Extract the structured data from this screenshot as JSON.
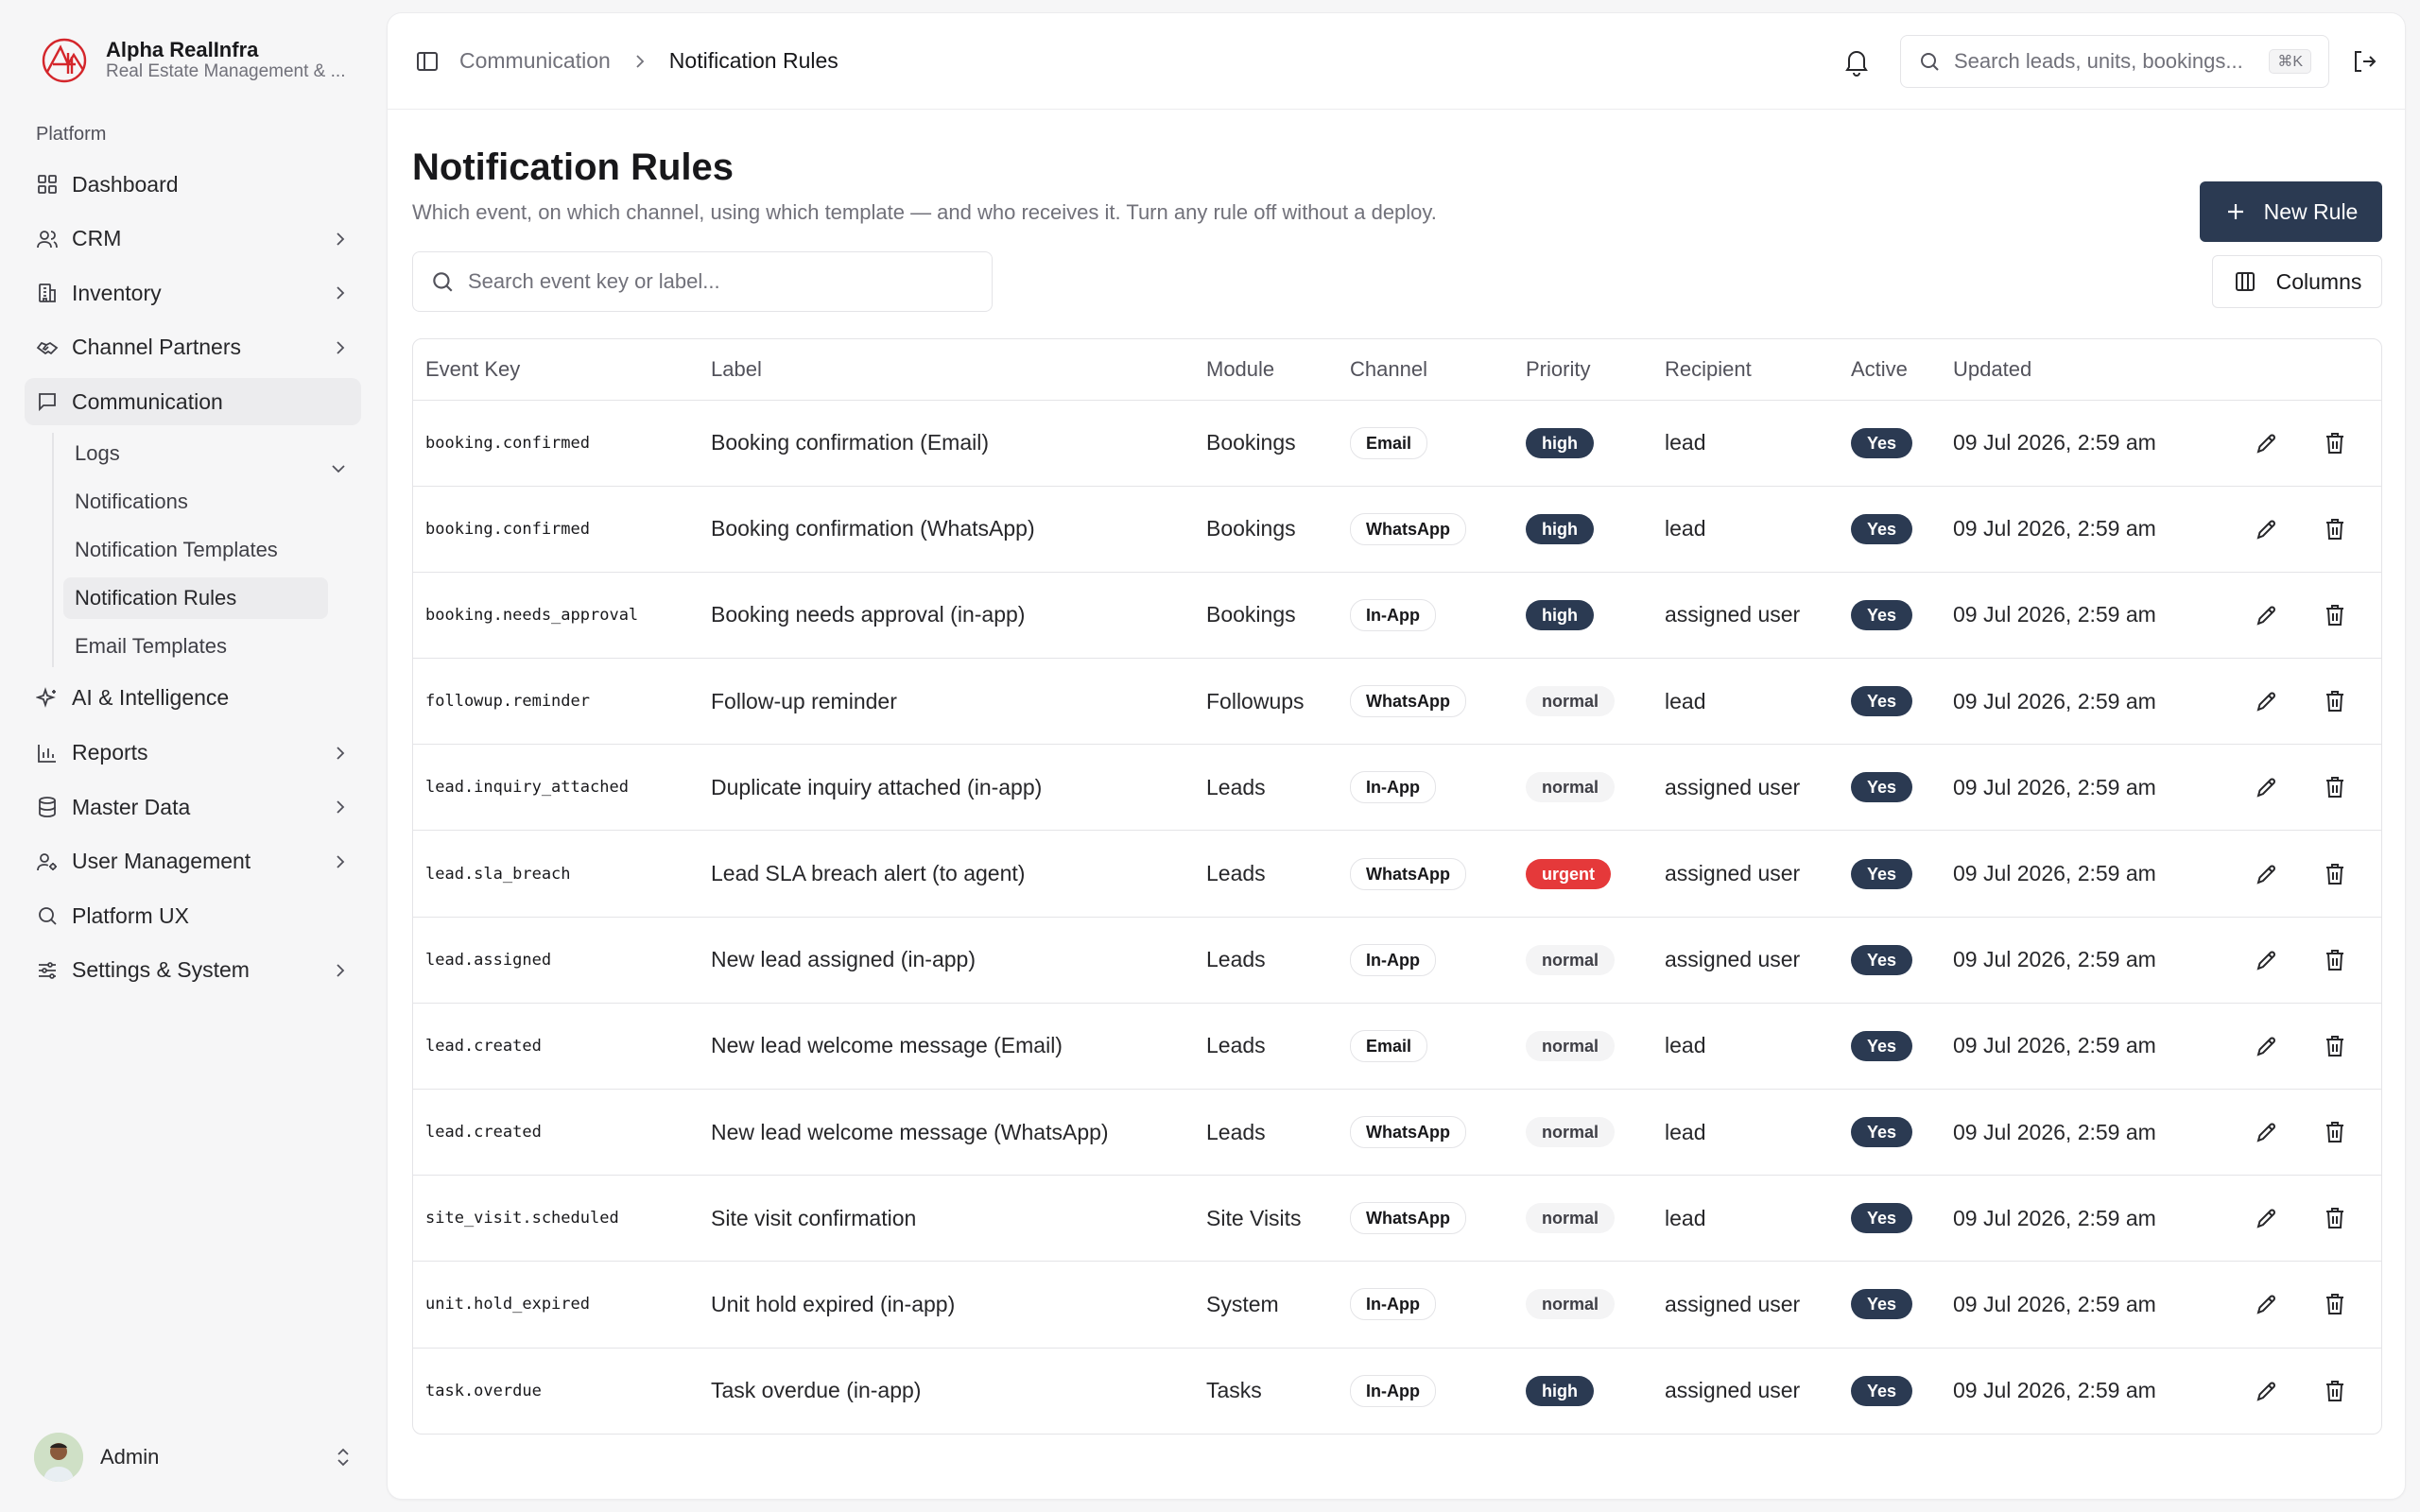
{
  "brand": {
    "name": "Alpha RealInfra",
    "subtitle": "Real Estate Management & ...",
    "accent": "#d4262b"
  },
  "sidebar": {
    "section_label": "Platform",
    "items": [
      {
        "label": "Dashboard",
        "icon": "grid-icon"
      },
      {
        "label": "CRM",
        "icon": "users-icon"
      },
      {
        "label": "Inventory",
        "icon": "building-icon"
      },
      {
        "label": "Channel Partners",
        "icon": "handshake-icon"
      },
      {
        "label": "Communication",
        "icon": "message-icon"
      },
      {
        "label": "AI & Intelligence",
        "icon": "sparkles-icon"
      },
      {
        "label": "Reports",
        "icon": "bar-chart-icon"
      },
      {
        "label": "Master Data",
        "icon": "database-icon"
      },
      {
        "label": "User Management",
        "icon": "user-cog-icon"
      },
      {
        "label": "Platform UX",
        "icon": "search-icon"
      },
      {
        "label": "Settings & System",
        "icon": "sliders-icon"
      }
    ],
    "sub_items": [
      {
        "label": "Logs"
      },
      {
        "label": "Notifications"
      },
      {
        "label": "Notification Templates"
      },
      {
        "label": "Notification Rules"
      },
      {
        "label": "Email Templates"
      }
    ]
  },
  "user": {
    "name": "Admin"
  },
  "topbar": {
    "breadcrumb_parent": "Communication",
    "breadcrumb_current": "Notification Rules",
    "search_placeholder": "Search leads, units, bookings...",
    "shortcut": "⌘K"
  },
  "page": {
    "title": "Notification Rules",
    "description": "Which event, on which channel, using which template — and who receives it. Turn any rule off without a deploy.",
    "new_button": "New Rule",
    "search_placeholder": "Search event key or label...",
    "columns_button": "Columns"
  },
  "table": {
    "headers": [
      "Event Key",
      "Label",
      "Module",
      "Channel",
      "Priority",
      "Recipient",
      "Active",
      "Updated"
    ],
    "rows": [
      {
        "event_key": "booking.confirmed",
        "label": "Booking confirmation (Email)",
        "module": "Bookings",
        "channel": "Email",
        "priority": "high",
        "recipient": "lead",
        "active": "Yes",
        "updated": "09 Jul 2026, 2:59 am"
      },
      {
        "event_key": "booking.confirmed",
        "label": "Booking confirmation (WhatsApp)",
        "module": "Bookings",
        "channel": "WhatsApp",
        "priority": "high",
        "recipient": "lead",
        "active": "Yes",
        "updated": "09 Jul 2026, 2:59 am"
      },
      {
        "event_key": "booking.needs_approval",
        "label": "Booking needs approval (in-app)",
        "module": "Bookings",
        "channel": "In-App",
        "priority": "high",
        "recipient": "assigned user",
        "active": "Yes",
        "updated": "09 Jul 2026, 2:59 am"
      },
      {
        "event_key": "followup.reminder",
        "label": "Follow-up reminder",
        "module": "Followups",
        "channel": "WhatsApp",
        "priority": "normal",
        "recipient": "lead",
        "active": "Yes",
        "updated": "09 Jul 2026, 2:59 am"
      },
      {
        "event_key": "lead.inquiry_attached",
        "label": "Duplicate inquiry attached (in-app)",
        "module": "Leads",
        "channel": "In-App",
        "priority": "normal",
        "recipient": "assigned user",
        "active": "Yes",
        "updated": "09 Jul 2026, 2:59 am"
      },
      {
        "event_key": "lead.sla_breach",
        "label": "Lead SLA breach alert (to agent)",
        "module": "Leads",
        "channel": "WhatsApp",
        "priority": "urgent",
        "recipient": "assigned user",
        "active": "Yes",
        "updated": "09 Jul 2026, 2:59 am"
      },
      {
        "event_key": "lead.assigned",
        "label": "New lead assigned (in-app)",
        "module": "Leads",
        "channel": "In-App",
        "priority": "normal",
        "recipient": "assigned user",
        "active": "Yes",
        "updated": "09 Jul 2026, 2:59 am"
      },
      {
        "event_key": "lead.created",
        "label": "New lead welcome message (Email)",
        "module": "Leads",
        "channel": "Email",
        "priority": "normal",
        "recipient": "lead",
        "active": "Yes",
        "updated": "09 Jul 2026, 2:59 am"
      },
      {
        "event_key": "lead.created",
        "label": "New lead welcome message (WhatsApp)",
        "module": "Leads",
        "channel": "WhatsApp",
        "priority": "normal",
        "recipient": "lead",
        "active": "Yes",
        "updated": "09 Jul 2026, 2:59 am"
      },
      {
        "event_key": "site_visit.scheduled",
        "label": "Site visit confirmation",
        "module": "Site Visits",
        "channel": "WhatsApp",
        "priority": "normal",
        "recipient": "lead",
        "active": "Yes",
        "updated": "09 Jul 2026, 2:59 am"
      },
      {
        "event_key": "unit.hold_expired",
        "label": "Unit hold expired (in-app)",
        "module": "System",
        "channel": "In-App",
        "priority": "normal",
        "recipient": "assigned user",
        "active": "Yes",
        "updated": "09 Jul 2026, 2:59 am"
      },
      {
        "event_key": "task.overdue",
        "label": "Task overdue (in-app)",
        "module": "Tasks",
        "channel": "In-App",
        "priority": "high",
        "recipient": "assigned user",
        "active": "Yes",
        "updated": "09 Jul 2026, 2:59 am"
      }
    ]
  },
  "colors": {
    "primary": "#2b3a52",
    "urgent": "#e5393a",
    "normal_bg": "#f4f4f5"
  }
}
